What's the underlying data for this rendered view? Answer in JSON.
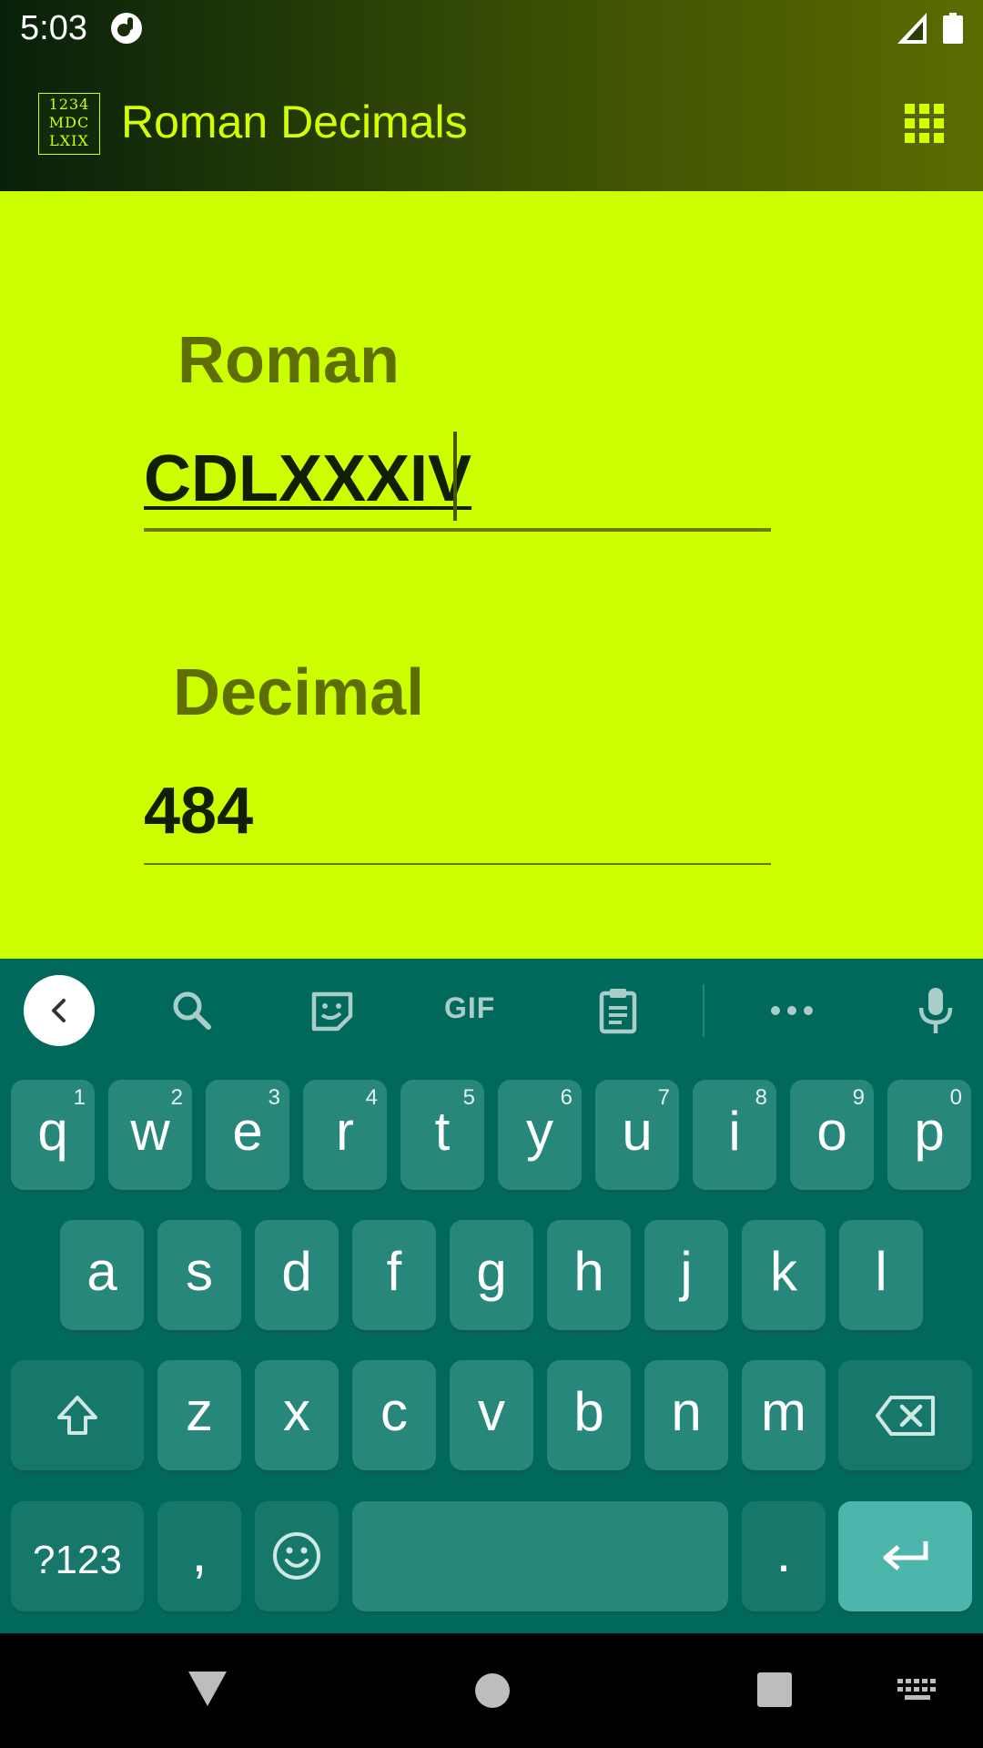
{
  "status_bar": {
    "time": "5:03"
  },
  "app_bar": {
    "logo_lines": [
      "1234",
      "MDC",
      "LXIX"
    ],
    "title": "Roman Decimals"
  },
  "form": {
    "roman_label": "Roman",
    "roman_value": "CDLXXXIV",
    "decimal_label": "Decimal",
    "decimal_value": "484"
  },
  "keyboard": {
    "toolbar": {
      "gif_label": "GIF"
    },
    "row1": [
      {
        "key": "q",
        "hint": "1"
      },
      {
        "key": "w",
        "hint": "2"
      },
      {
        "key": "e",
        "hint": "3"
      },
      {
        "key": "r",
        "hint": "4"
      },
      {
        "key": "t",
        "hint": "5"
      },
      {
        "key": "y",
        "hint": "6"
      },
      {
        "key": "u",
        "hint": "7"
      },
      {
        "key": "i",
        "hint": "8"
      },
      {
        "key": "o",
        "hint": "9"
      },
      {
        "key": "p",
        "hint": "0"
      }
    ],
    "row2": [
      "a",
      "s",
      "d",
      "f",
      "g",
      "h",
      "j",
      "k",
      "l"
    ],
    "row3": [
      "z",
      "x",
      "c",
      "v",
      "b",
      "n",
      "m"
    ],
    "row4": {
      "symbols": "?123",
      "comma": ",",
      "period": "."
    }
  },
  "colors": {
    "content_bg": "#ccff00",
    "label": "#5e6e00",
    "title": "#d4ff00",
    "keyboard_bg": "#00695c",
    "key": "#26877a",
    "enter_key": "#4db6ac"
  }
}
